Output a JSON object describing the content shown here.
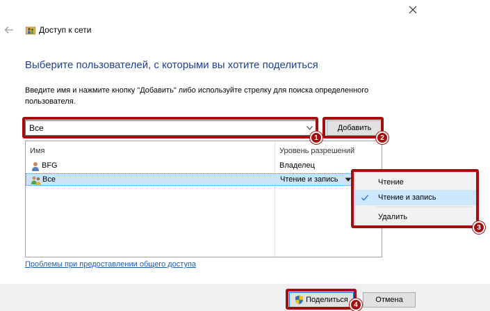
{
  "window": {
    "title": "Доступ к сети"
  },
  "heading": "Выберите пользователей, с которыми вы хотите поделиться",
  "instruction": "Введите имя и нажмите кнопку \"Добавить\" либо используйте стрелку для поиска определенного пользователя.",
  "combo": {
    "value": "Все"
  },
  "add_label": "Добавить",
  "list": {
    "columns": [
      "Имя",
      "Уровень разрешений"
    ],
    "rows": [
      {
        "name": "BFG",
        "permission": "Владелец"
      },
      {
        "name": "Все",
        "permission": "Чтение и запись"
      }
    ]
  },
  "menu": {
    "items": [
      {
        "label": "Чтение",
        "checked": false
      },
      {
        "label": "Чтение и запись",
        "checked": true
      },
      {
        "label": "Удалить",
        "checked": false
      }
    ]
  },
  "problems_link": "Проблемы при предоставлении общего доступа",
  "footer": {
    "share_label": "Поделиться",
    "cancel_label": "Отмена"
  },
  "annotations": {
    "badges": [
      "1",
      "2",
      "3",
      "4"
    ],
    "color": "#a50e0e"
  },
  "colors": {
    "heading": "#1f3f8f",
    "selection": "#cce4f7",
    "link": "#1a5fb4"
  }
}
